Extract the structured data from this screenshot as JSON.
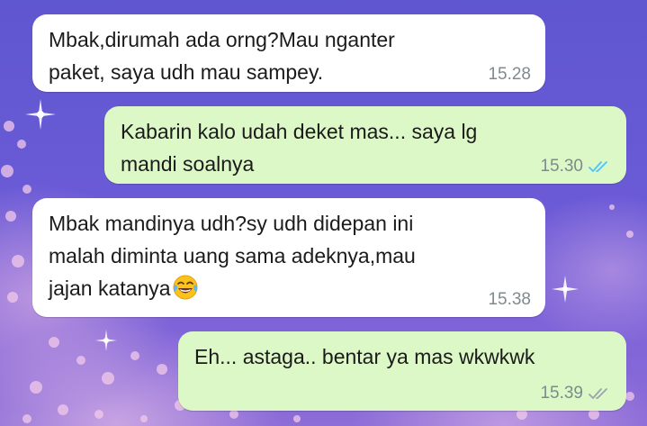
{
  "chat": {
    "messages": [
      {
        "direction": "incoming",
        "lines": [
          "Mbak,dirumah ada orng?Mau nganter",
          "paket, saya udh mau sampey."
        ],
        "time": "15.28"
      },
      {
        "direction": "outgoing",
        "lines": [
          "Kabarin kalo udah deket mas... saya lg",
          "mandi soalnya"
        ],
        "time": "15.30",
        "status_icon": "double-check-read-icon",
        "status_color": "#4fc3f7"
      },
      {
        "direction": "incoming",
        "lines": [
          "Mbak mandinya udh?sy udh didepan ini",
          "malah diminta uang sama adeknya,mau",
          "jajan katanya"
        ],
        "emoji": "face-with-tears-of-joy-emoji",
        "time": "15.38"
      },
      {
        "direction": "outgoing",
        "lines": [
          "Eh... astaga.. bentar ya mas wkwkwk"
        ],
        "time": "15.39",
        "status_icon": "double-check-delivered-icon",
        "status_color": "#9aa5a9"
      }
    ]
  },
  "colors": {
    "incoming_bubble": "#ffffff",
    "outgoing_bubble": "#dcf8c6",
    "wallpaper": "#6a5ad6"
  }
}
